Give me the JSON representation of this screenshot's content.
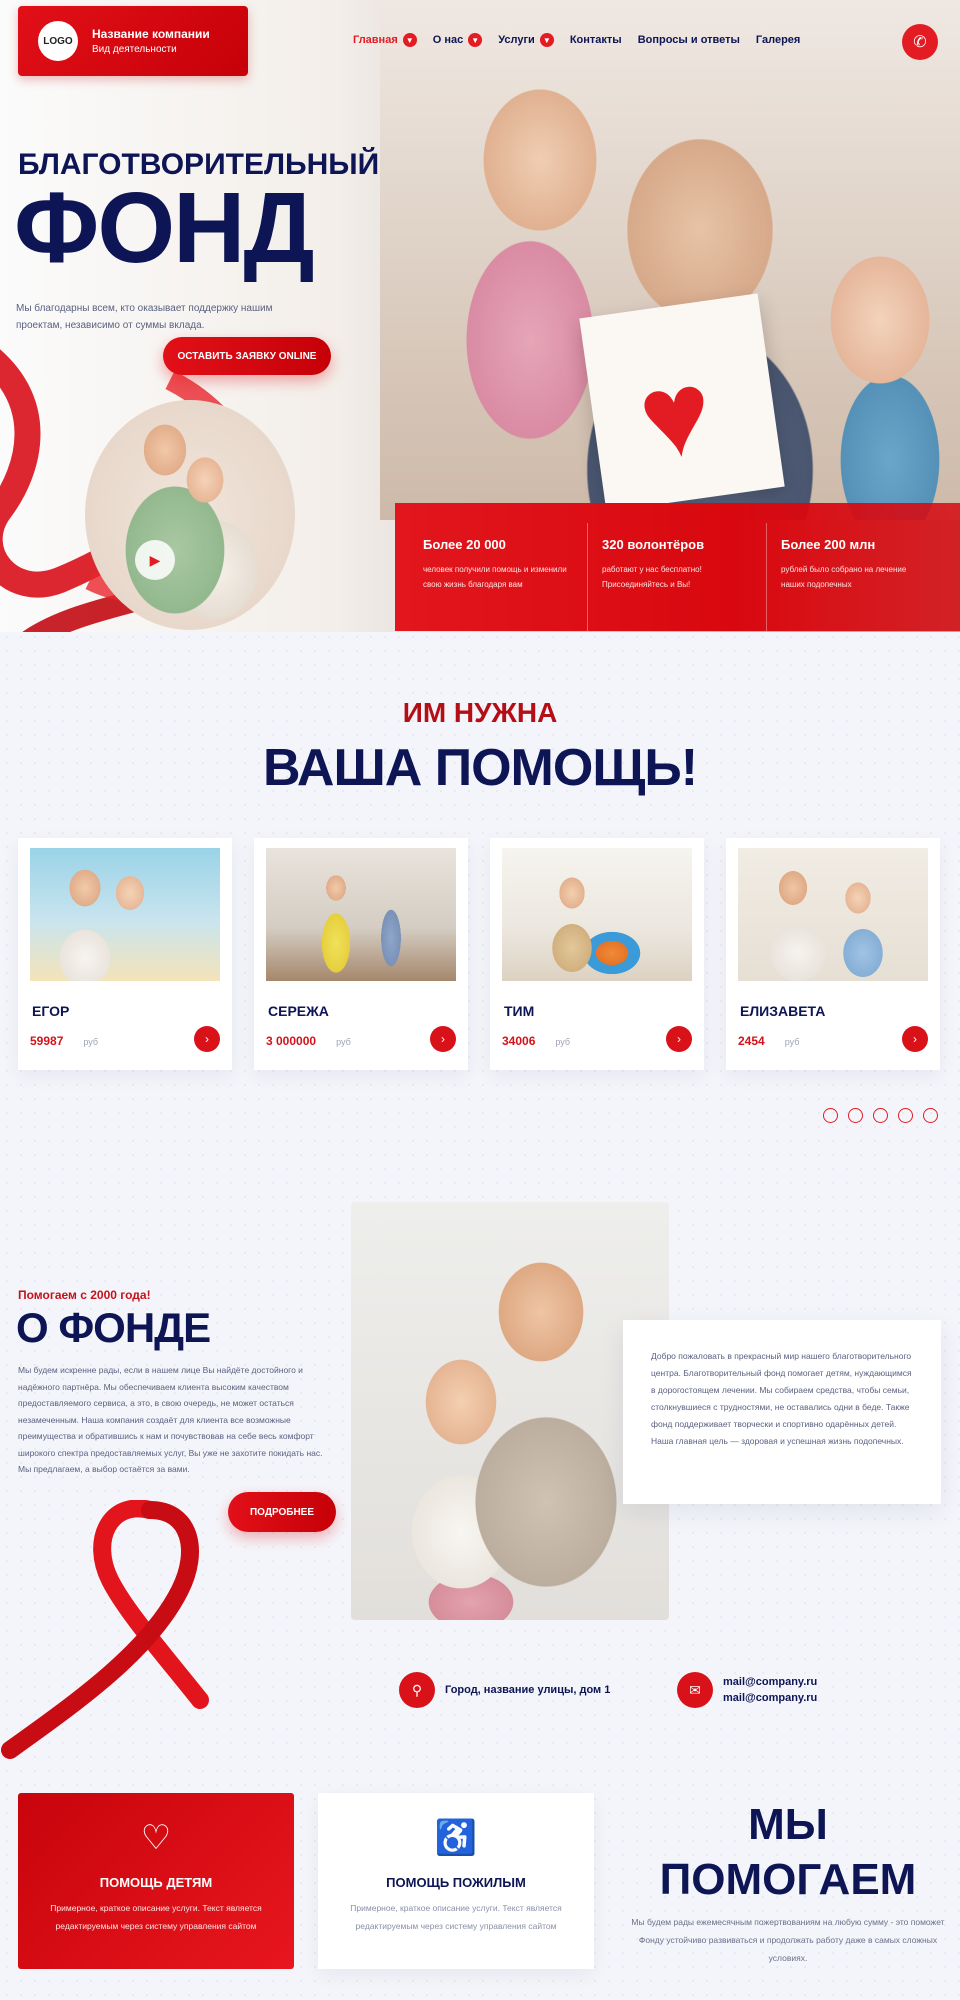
{
  "header": {
    "logo": "LOGO",
    "company_name": "Название компании",
    "company_sub": "Вид деятельности",
    "nav": [
      {
        "label": "Главная",
        "dropdown": true,
        "active": true
      },
      {
        "label": "О нас",
        "dropdown": true,
        "active": false
      },
      {
        "label": "Услуги",
        "dropdown": true,
        "active": false
      },
      {
        "label": "Контакты",
        "dropdown": false,
        "active": false
      },
      {
        "label": "Вопросы и ответы",
        "dropdown": false,
        "active": false
      },
      {
        "label": "Галерея",
        "dropdown": false,
        "active": false
      }
    ],
    "phone_icon": "phone-icon"
  },
  "hero": {
    "eyebrow": "БЛАГОТВОРИТЕЛЬНЫЙ",
    "title": "ФОНД",
    "description": "Мы благодарны всем, кто оказывает поддержку нашим проектам, независимо от суммы вклада.",
    "cta": "ОСТАВИТЬ ЗАЯВКУ ONLINE"
  },
  "stats": [
    {
      "title": "Более 20 000",
      "text": "человек получили помощь и изменили свою жизнь благодаря вам"
    },
    {
      "title": "320 волонтёров",
      "text": "работают у нас бесплатно! Присоединяйтесь и Вы!"
    },
    {
      "title": "Более 200 млн",
      "text": "рублей было собрано на лечение наших подопечных"
    }
  ],
  "help": {
    "pre": "ИМ НУЖНА",
    "title": "ВАША ПОМОЩЬ!",
    "cards": [
      {
        "name": "ЕГОР",
        "amount": "59987",
        "unit": "руб"
      },
      {
        "name": "СЕРЕЖА",
        "amount": "3 000000",
        "unit": "руб"
      },
      {
        "name": "ТИМ",
        "amount": "34006",
        "unit": "руб"
      },
      {
        "name": "ЕЛИЗАВЕТА",
        "amount": "2454",
        "unit": "руб"
      }
    ]
  },
  "about": {
    "pre": "Помогаем с 2000 года!",
    "title": "О ФОНДЕ",
    "text": "Мы будем искренне рады, если в нашем лице Вы найдёте достойного и надёжного партнёра. Мы обеспечиваем клиента высоким качеством предоставляемого сервиса, а это, в свою очередь, не может остаться незамеченным. Наша компания создаёт для клиента все возможные преимущества и обратившись к нам и почувствовав на себе весь комфорт широкого спектра предоставляемых услуг, Вы уже не захотите покидать нас. Мы предлагаем, а выбор остаётся за вами.",
    "button": "ПОДРОБНЕЕ",
    "box_text": "Добро пожаловать в прекрасный мир нашего благотворительного центра. Благотворительный фонд помогает детям, нуждающимся в дорогостоящем лечении. Мы собираем средства, чтобы семьи, столкнувшиеся с трудностями, не оставались одни в беде. Также фонд поддерживает творчески и спортивно одарённых детей. Наша главная цель — здоровая и успешная жизнь подопечных."
  },
  "contacts": {
    "address": "Город, название улицы, дом 1",
    "email1": "mail@company.ru",
    "email2": "mail@company.ru"
  },
  "services": [
    {
      "title": "ПОМОЩЬ ДЕТЯМ",
      "text": "Примерное, краткое описание услуги. Текст является редактируемым через систему управления сайтом",
      "icon": "heart-hand-icon"
    },
    {
      "title": "ПОМОЩЬ ПОЖИЛЫМ",
      "text": "Примерное, краткое описание услуги. Текст является редактируемым через систему управления сайтом",
      "icon": "elderly-help-icon"
    }
  ],
  "we_help": {
    "line1": "МЫ",
    "line2": "ПОМОГАЕМ",
    "text": "Мы будем рады ежемесячным пожертвованиям на любую сумму - это поможет Фонду устойчиво развиваться и продолжать работу даже в самых сложных условиях."
  },
  "colors": {
    "accent": "#e31c23",
    "dark": "#0d1554"
  }
}
